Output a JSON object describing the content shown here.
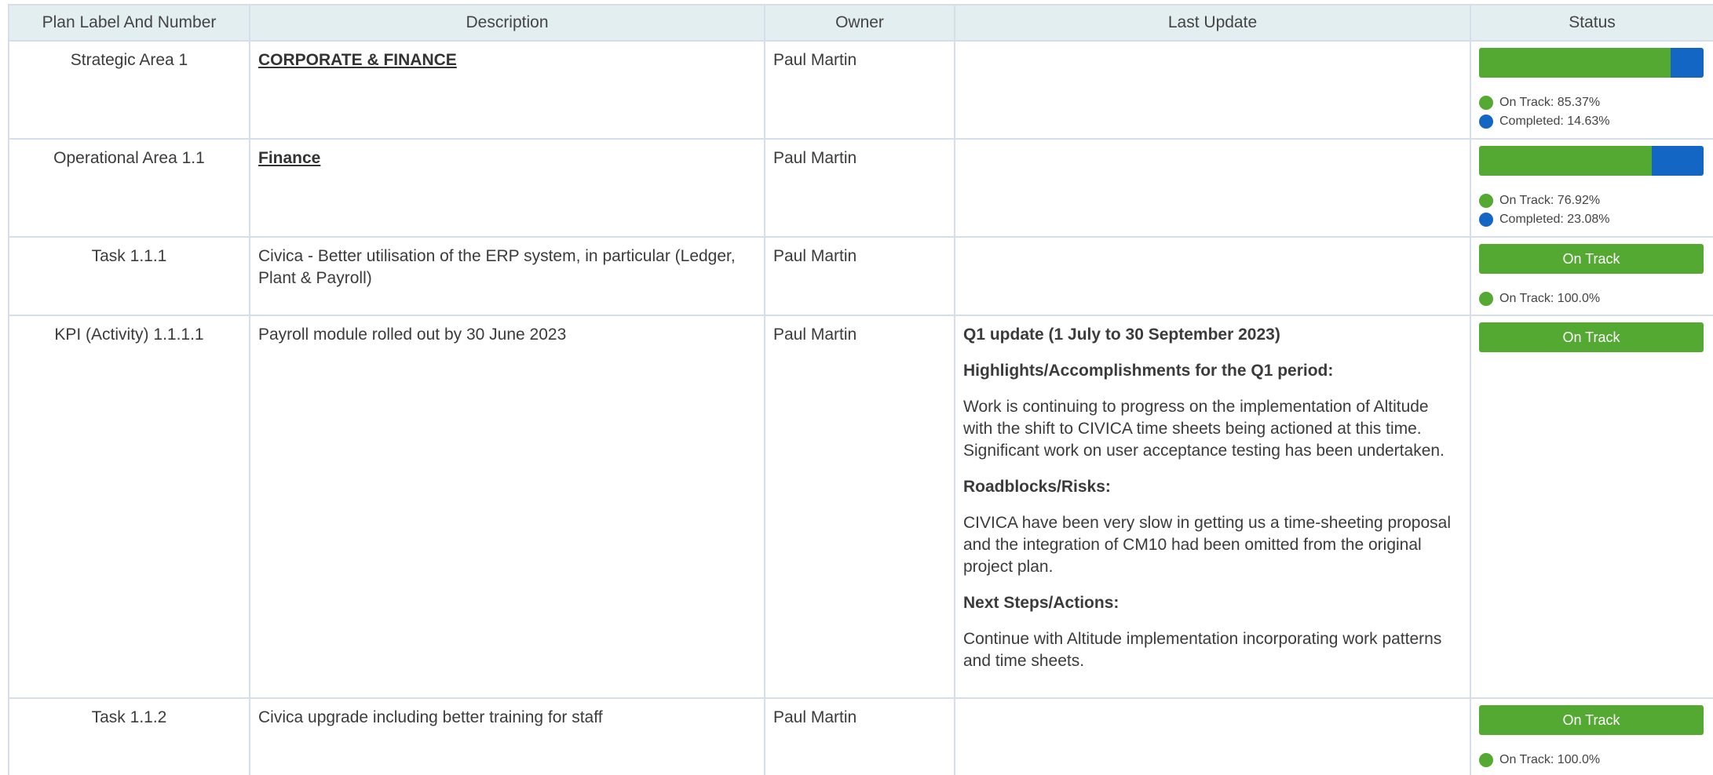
{
  "colors": {
    "on_track": "#54a932",
    "completed": "#1466c4",
    "header_bg": "#e3eef0",
    "border": "#d6deea"
  },
  "table": {
    "headers": [
      "Plan Label And Number",
      "Description",
      "Owner",
      "Last Update",
      "Status"
    ],
    "rows": [
      {
        "label": "Strategic Area 1",
        "description": "CORPORATE & FINANCE",
        "owner": "Paul Martin",
        "status": {
          "on_track_pct": 85.37,
          "completed_pct": 14.63,
          "legend": [
            "On Track: 85.37%",
            "Completed: 14.63%"
          ]
        }
      },
      {
        "label": "Operational Area 1.1",
        "description": "Finance",
        "owner": "Paul Martin",
        "status": {
          "on_track_pct": 76.92,
          "completed_pct": 23.08,
          "legend": [
            "On Track: 76.92%",
            "Completed: 23.08%"
          ]
        }
      },
      {
        "label": "Task 1.1.1",
        "description": "Civica - Better utilisation of the ERP system, in particular (Ledger, Plant & Payroll)",
        "owner": "Paul Martin",
        "status": {
          "pill": "On Track",
          "legend": [
            "On Track: 100.0%"
          ]
        }
      },
      {
        "label": "KPI (Activity) 1.1.1.1",
        "description": "Payroll module rolled out by 30 June 2023",
        "owner": "Paul Martin",
        "update": {
          "title": "Q1 update (1 July to 30 September 2023)",
          "highlights_heading": "Highlights/Accomplishments for the Q1 period:",
          "highlights": "Work is continuing to progress on the implementation of Altitude with the shift to CIVICA time sheets being actioned at this time. Significant work on user acceptance testing has been undertaken.",
          "roadblocks_heading": "Roadblocks/Risks:",
          "roadblocks": "CIVICA have been very slow in getting us a time-sheeting proposal and the integration of CM10 had been omitted from the original project plan.",
          "next_heading": "Next Steps/Actions:",
          "next": "Continue with Altitude implementation incorporating work patterns and time sheets."
        },
        "status": {
          "pill": "On Track"
        }
      },
      {
        "label": "Task 1.1.2",
        "description": "Civica upgrade including better training for staff",
        "owner": "Paul Martin",
        "status": {
          "pill": "On Track",
          "legend": [
            "On Track: 100.0%"
          ]
        }
      }
    ]
  }
}
